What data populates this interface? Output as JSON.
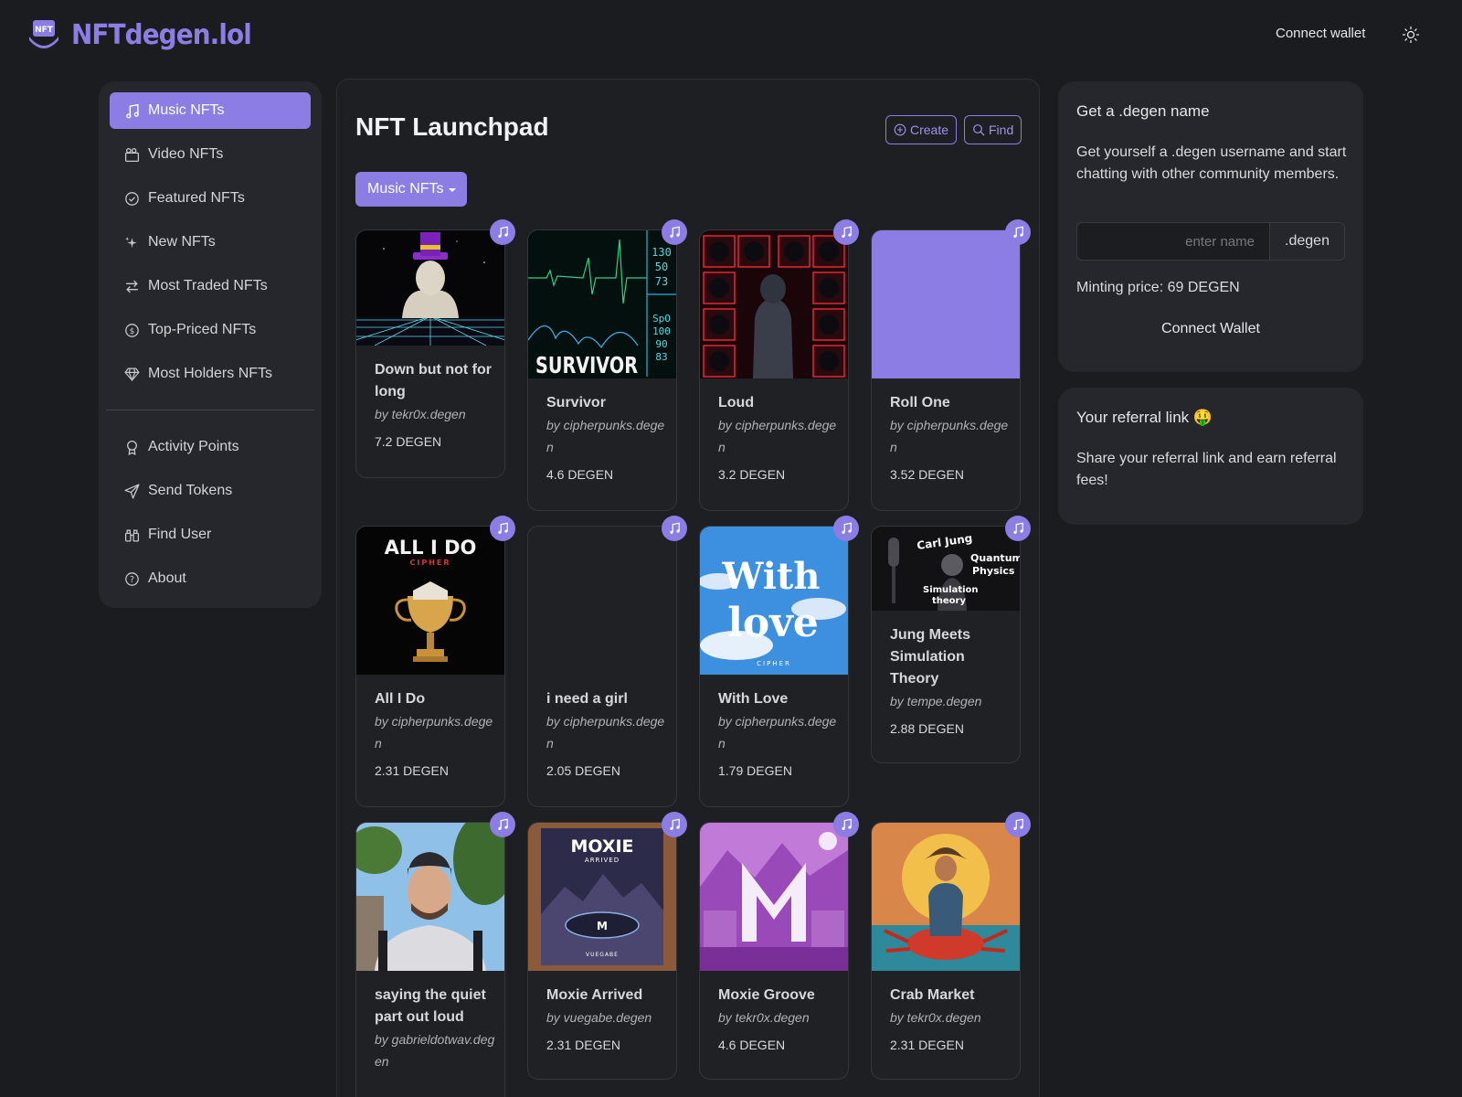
{
  "brand": {
    "name": "NFTdegen.lol",
    "logo_badge": "NFT",
    "accent": "#8b7de3"
  },
  "header": {
    "connect_label": "Connect wallet",
    "theme_icon": "sun-icon"
  },
  "sidebar": {
    "items": [
      {
        "label": "Music NFTs",
        "icon": "music-note-icon",
        "active": true
      },
      {
        "label": "Video NFTs",
        "icon": "video-camera-icon"
      },
      {
        "label": "Featured NFTs",
        "icon": "badge-check-icon"
      },
      {
        "label": "New NFTs",
        "icon": "sparkles-icon"
      },
      {
        "label": "Most Traded NFTs",
        "icon": "arrows-exchange-icon"
      },
      {
        "label": "Top-Priced NFTs",
        "icon": "coin-icon"
      },
      {
        "label": "Most Holders NFTs",
        "icon": "gem-icon"
      }
    ],
    "secondary": [
      {
        "label": "Activity Points",
        "icon": "award-icon"
      },
      {
        "label": "Send Tokens",
        "icon": "send-icon"
      },
      {
        "label": "Find User",
        "icon": "binoculars-icon"
      },
      {
        "label": "About",
        "icon": "question-circle-icon"
      }
    ]
  },
  "main": {
    "title": "NFT Launchpad",
    "create_label": "Create",
    "find_label": "Find",
    "category_label": "Music NFTs",
    "cards": [
      {
        "title": "Down but not for long",
        "author": "by tekr0x.degen",
        "price": "7.2 DEGEN"
      },
      {
        "title": "Survivor",
        "author": "by cipherpunks.degen",
        "price": "4.6 DEGEN"
      },
      {
        "title": "Loud",
        "author": "by cipherpunks.degen",
        "price": "3.2 DEGEN"
      },
      {
        "title": "Roll One",
        "author": "by cipherpunks.degen",
        "price": "3.52 DEGEN"
      },
      {
        "title": "All I Do",
        "author": "by cipherpunks.degen",
        "price": "2.31 DEGEN"
      },
      {
        "title": "i need a girl",
        "author": "by cipherpunks.degen",
        "price": "2.05 DEGEN"
      },
      {
        "title": "With Love",
        "author": "by cipherpunks.degen",
        "price": "1.79 DEGEN"
      },
      {
        "title": "Jung Meets Simulation Theory",
        "author": "by tempe.degen",
        "price": "2.88 DEGEN"
      },
      {
        "title": "saying the quiet part out loud",
        "author": "by gabrieldotwav.degen",
        "price": ""
      },
      {
        "title": "Moxie Arrived",
        "author": "by vuegabe.degen",
        "price": "2.31 DEGEN"
      },
      {
        "title": "Moxie Groove",
        "author": "by tekr0x.degen",
        "price": "4.6 DEGEN"
      },
      {
        "title": "Crab Market",
        "author": "by tekr0x.degen",
        "price": "2.31 DEGEN"
      }
    ],
    "art_text": {
      "survivor": "SURVIVOR",
      "survivor_vitals": [
        "130",
        "50",
        "73"
      ],
      "survivor_spo2": [
        "SpO",
        "100",
        "90",
        "83"
      ],
      "all_i_do": "ALL I DO",
      "all_i_do_sub": "CIPHER",
      "with_love_1": "With",
      "with_love_2": "love",
      "with_love_sub": "CIPHER",
      "jung_1": "Carl Jung",
      "jung_2": "Quantum",
      "jung_3": "Physics",
      "jung_4": "Simulation",
      "jung_5": "theory",
      "moxie": "MOXIE",
      "moxie_sub": "ARRIVED",
      "moxie_artist": "VUEGABE"
    }
  },
  "degen_panel": {
    "title": "Get a .degen name",
    "description": "Get yourself a .degen username and start chatting with other community members.",
    "input_placeholder": "enter name",
    "suffix": ".degen",
    "minting_price": "Minting price: 69 DEGEN",
    "button": "Connect Wallet"
  },
  "referral_panel": {
    "title": "Your referral link",
    "emoji": "🤑",
    "description": "Share your referral link and earn referral fees!"
  }
}
